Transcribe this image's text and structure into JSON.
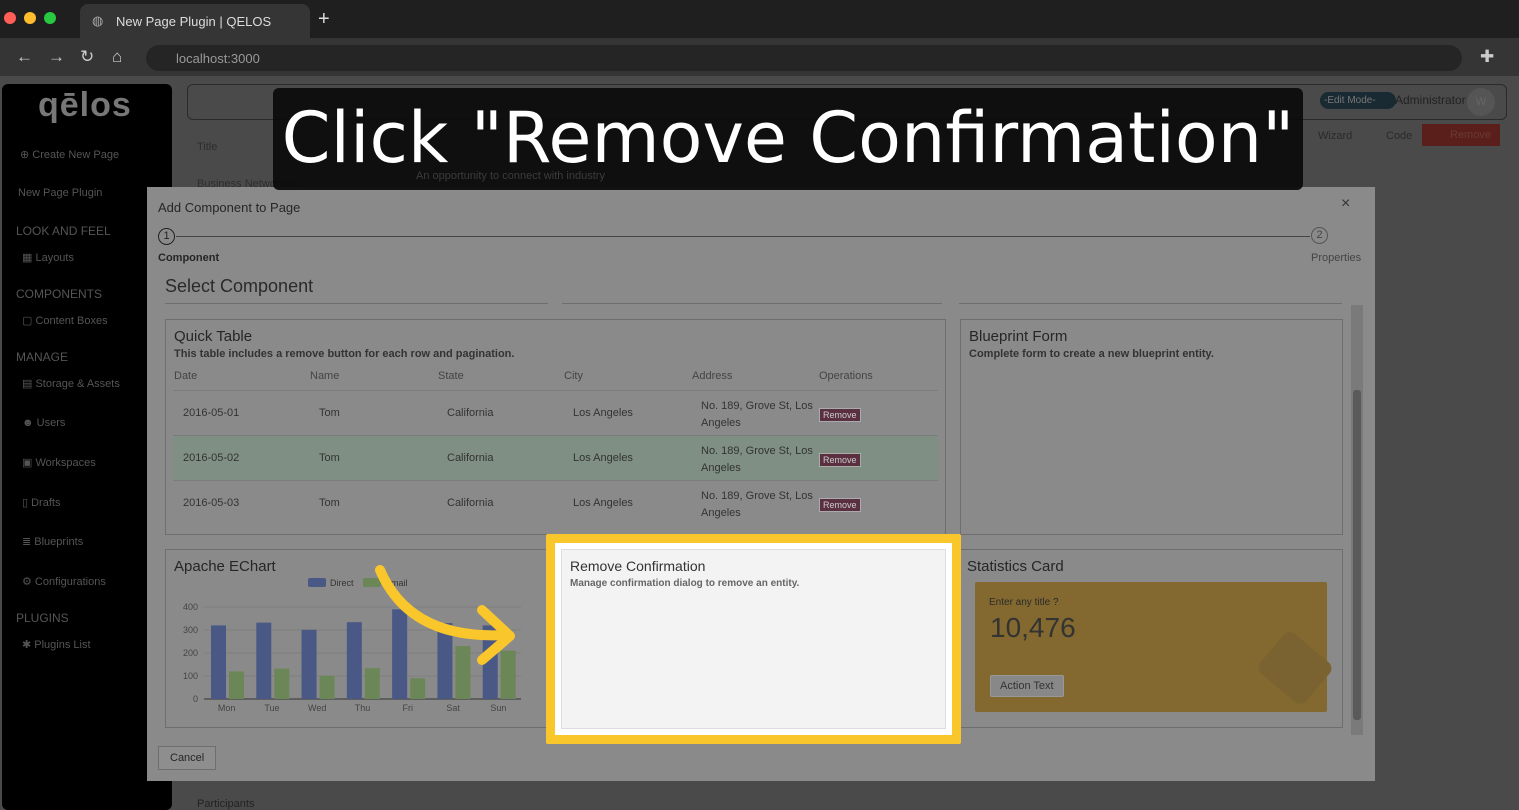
{
  "browser": {
    "tab_title": "New Page Plugin | QELOS",
    "url": "localhost:3000"
  },
  "sidebar": {
    "logo": "qēlos",
    "create": "Create New Page",
    "page": "New Page Plugin",
    "sections": [
      {
        "title": "LOOK AND FEEL",
        "items": [
          "Layouts"
        ]
      },
      {
        "title": "COMPONENTS",
        "items": [
          "Content Boxes"
        ]
      },
      {
        "title": "MANAGE",
        "items": [
          "Storage & Assets",
          "Users",
          "Workspaces",
          "Drafts",
          "Blueprints",
          "Configurations"
        ]
      },
      {
        "title": "PLUGINS",
        "items": [
          "Plugins List"
        ]
      }
    ]
  },
  "header": {
    "edit_mode": "-Edit Mode-",
    "user": "Administrator",
    "avatar": "W",
    "wizard": "Wizard",
    "code": "Code",
    "remove": "Remove"
  },
  "background": {
    "title_col": "Title",
    "row1": "Business Networking",
    "desc": "An opportunity to connect with industry",
    "participants": "Participants"
  },
  "caption": "Click \"Remove Confirmation\"",
  "modal": {
    "title": "Add Component to Page",
    "close": "×",
    "steps": [
      {
        "num": "1",
        "label": "Component"
      },
      {
        "num": "2",
        "label": "Properties"
      }
    ],
    "heading": "Select Component",
    "cancel": "Cancel",
    "quick_table": {
      "title": "Quick Table",
      "desc": "This table includes a remove button for each row and pagination.",
      "columns": [
        "Date",
        "Name",
        "State",
        "City",
        "Address",
        "Operations"
      ],
      "rows": [
        [
          "2016-05-01",
          "Tom",
          "California",
          "Los Angeles",
          "No. 189, Grove St, Los Angeles",
          "Remove"
        ],
        [
          "2016-05-02",
          "Tom",
          "California",
          "Los Angeles",
          "No. 189, Grove St, Los Angeles",
          "Remove"
        ],
        [
          "2016-05-03",
          "Tom",
          "California",
          "Los Angeles",
          "No. 189, Grove St, Los Angeles",
          "Remove"
        ]
      ]
    },
    "blueprint_form": {
      "title": "Blueprint Form",
      "desc": "Complete form to create a new blueprint entity."
    },
    "echart": {
      "title": "Apache EChart"
    },
    "remove_confirmation": {
      "title": "Remove Confirmation",
      "desc": "Manage confirmation dialog to remove an entity."
    },
    "statistics": {
      "title": "Statistics Card",
      "label": "Enter any title",
      "value": "10,476",
      "action": "Action Text"
    }
  },
  "chart_data": {
    "type": "bar",
    "categories": [
      "Mon",
      "Tue",
      "Wed",
      "Thu",
      "Fri",
      "Sat",
      "Sun"
    ],
    "series": [
      {
        "name": "Direct",
        "values": [
          320,
          332,
          301,
          334,
          390,
          330,
          320
        ],
        "color": "#4a5886"
      },
      {
        "name": "Email",
        "values": [
          120,
          132,
          101,
          134,
          90,
          230,
          210
        ],
        "color": "#6b8757"
      }
    ],
    "ylim": [
      0,
      400
    ],
    "yticks": [
      0,
      100,
      200,
      300,
      400
    ],
    "legend": "top-center",
    "grid": true
  },
  "colors": {
    "highlight": "#f9c62b",
    "remove_button": "#5a3040"
  }
}
